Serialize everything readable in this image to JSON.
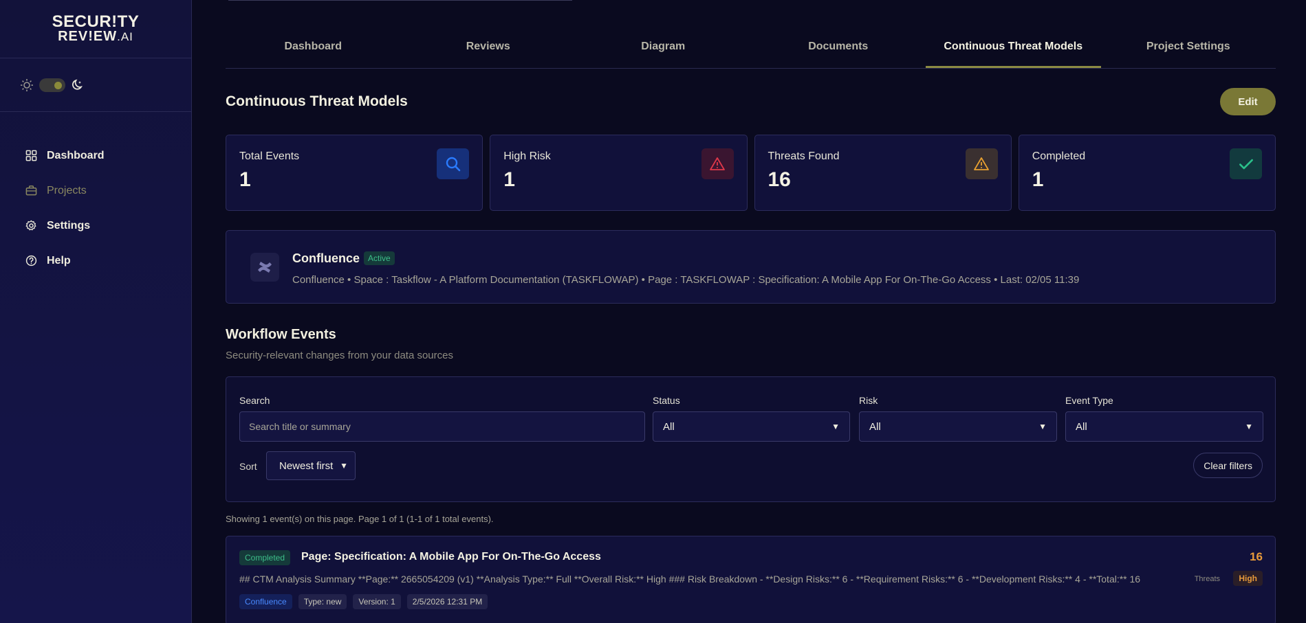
{
  "brand": {
    "line1": "SECUR!TY",
    "line2_main": "REV!EW",
    "line2_suffix": ".AI"
  },
  "sidebar": {
    "items": [
      {
        "label": "Dashboard",
        "icon": "grid-icon"
      },
      {
        "label": "Projects",
        "icon": "briefcase-icon"
      },
      {
        "label": "Settings",
        "icon": "gear-icon"
      },
      {
        "label": "Help",
        "icon": "help-circle-icon"
      }
    ]
  },
  "tabs": [
    "Dashboard",
    "Reviews",
    "Diagram",
    "Documents",
    "Continuous Threat Models",
    "Project Settings"
  ],
  "active_tab": "Continuous Threat Models",
  "header": {
    "title": "Continuous Threat Models",
    "edit_label": "Edit"
  },
  "stats": [
    {
      "label": "Total Events",
      "value": "1",
      "icon": "search-icon",
      "color": "#2a7bff"
    },
    {
      "label": "High Risk",
      "value": "1",
      "icon": "warning-icon",
      "color": "#e0384a"
    },
    {
      "label": "Threats Found",
      "value": "16",
      "icon": "warning-icon",
      "color": "#e8a030"
    },
    {
      "label": "Completed",
      "value": "1",
      "icon": "check-icon",
      "color": "#2ac08a"
    }
  ],
  "source": {
    "name": "Confluence",
    "status": "Active",
    "meta": "Confluence  •  Space : Taskflow - A Platform Documentation (TASKFLOWAP)  •  Page : TASKFLOWAP : Specification: A Mobile App For On-The-Go Access  •  Last: 02/05 11:39"
  },
  "workflow": {
    "title": "Workflow Events",
    "subtitle": "Security-relevant changes from your data sources",
    "filters": {
      "search_label": "Search",
      "search_placeholder": "Search title or summary",
      "status_label": "Status",
      "status_value": "All",
      "risk_label": "Risk",
      "risk_value": "All",
      "type_label": "Event Type",
      "type_value": "All",
      "sort_label": "Sort",
      "sort_value": "Newest first",
      "clear_label": "Clear filters"
    },
    "showing": "Showing 1 event(s) on this page. Page 1 of 1 (1-1 of 1 total events).",
    "events": [
      {
        "status": "Completed",
        "title": "Page: Specification: A Mobile App For On-The-Go Access",
        "summary": "## CTM Analysis Summary **Page:** 2665054209 (v1) **Analysis Type:** Full **Overall Risk:** High ### Risk Breakdown - **Design Risks:** 6 - **Requirement Risks:** 6 - **Development Risks:** 4 - **Total:** 16",
        "source_tag": "Confluence",
        "type_tag": "Type: new",
        "version_tag": "Version: 1",
        "date_tag": "2/5/2026 12:31 PM",
        "threat_count": "16",
        "threats_label": "Threats",
        "risk": "High"
      }
    ]
  }
}
